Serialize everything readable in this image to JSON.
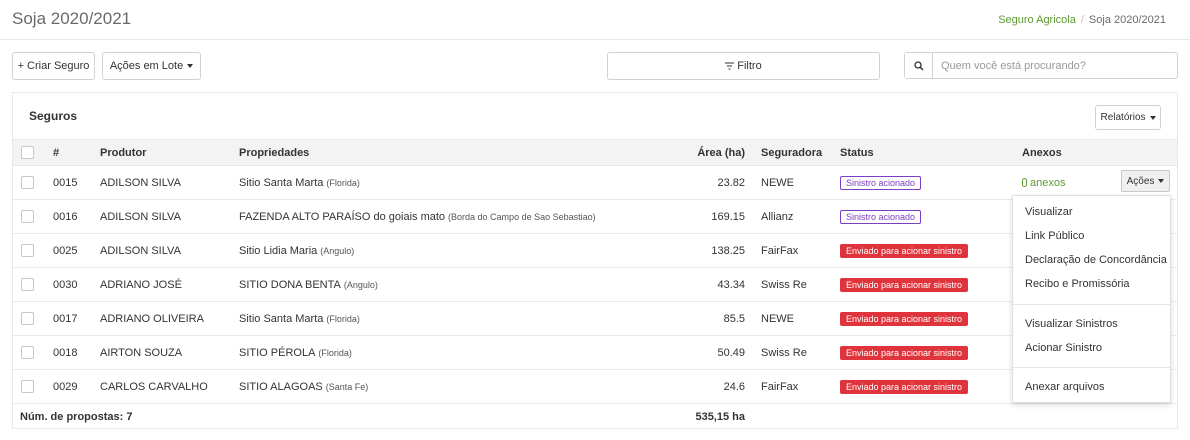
{
  "header": {
    "title": "Soja 2020/2021",
    "breadcrumb": [
      "Seguro Agricola",
      "Soja 2020/2021"
    ]
  },
  "toolbar": {
    "create_label": "+ Criar Seguro",
    "bulk_label": "Ações em Lote",
    "filter_label": "Filtro",
    "search_placeholder": "Quem você está procurando?"
  },
  "panel": {
    "title": "Seguros",
    "reports_label": "Relatórios"
  },
  "table": {
    "headers": [
      "#",
      "Produtor",
      "Propriedades",
      "Área (ha)",
      "Seguradora",
      "Status",
      "Anexos"
    ],
    "rows": [
      {
        "id": "0015",
        "producer": "ADILSON SILVA",
        "property": "Sitio Santa Marta",
        "location": "(Florida)",
        "area": "23.82",
        "insurer": "NEWE",
        "status": "Sinistro acionado",
        "status_style": "outline",
        "anexos": "anexos"
      },
      {
        "id": "0016",
        "producer": "ADILSON SILVA",
        "property": "FAZENDA ALTO PARAÍSO do goiais mato",
        "location": "(Borda do Campo de Sao Sebastiao)",
        "area": "169.15",
        "insurer": "Allianz",
        "status": "Sinistro acionado",
        "status_style": "outline",
        "anexos": ""
      },
      {
        "id": "0025",
        "producer": "ADILSON SILVA",
        "property": "Sitio Lidia Maria",
        "location": "(Angulo)",
        "area": "138.25",
        "insurer": "FairFax",
        "status": "Enviado para acionar sinistro",
        "status_style": "danger",
        "anexos": ""
      },
      {
        "id": "0030",
        "producer": "ADRIANO JOSÉ",
        "property": "SITIO DONA BENTA",
        "location": "(Angulo)",
        "area": "43.34",
        "insurer": "Swiss Re",
        "status": "Enviado para acionar sinistro",
        "status_style": "danger",
        "anexos": ""
      },
      {
        "id": "0017",
        "producer": "ADRIANO OLIVEIRA",
        "property": "Sitio Santa Marta",
        "location": "(Florida)",
        "area": "85.5",
        "insurer": "NEWE",
        "status": "Enviado para acionar sinistro",
        "status_style": "danger",
        "anexos": ""
      },
      {
        "id": "0018",
        "producer": "AIRTON SOUZA",
        "property": "SITIO PÉROLA",
        "location": "(Florida)",
        "area": "50.49",
        "insurer": "Swiss Re",
        "status": "Enviado para acionar sinistro",
        "status_style": "danger",
        "anexos": ""
      },
      {
        "id": "0029",
        "producer": "CARLOS CARVALHO",
        "property": "SITIO ALAGOAS",
        "location": "(Santa Fe)",
        "area": "24.6",
        "insurer": "FairFax",
        "status": "Enviado para acionar sinistro",
        "status_style": "danger",
        "anexos": ""
      }
    ],
    "footer_count": "Núm. de propostas: 7",
    "footer_area": "535,15 ha"
  },
  "actions": {
    "button_label": "Ações",
    "menu_group1": [
      "Visualizar",
      "Link Público",
      "Declaração de Concordância",
      "Recibo e Promissória"
    ],
    "menu_group2": [
      "Visualizar Sinistros",
      "Acionar Sinistro"
    ],
    "menu_group3": [
      "Anexar arquivos"
    ]
  },
  "colors": {
    "accent_green": "#5c9b33",
    "danger": "#e0343c",
    "outline_purple": "#7b3fc3"
  }
}
